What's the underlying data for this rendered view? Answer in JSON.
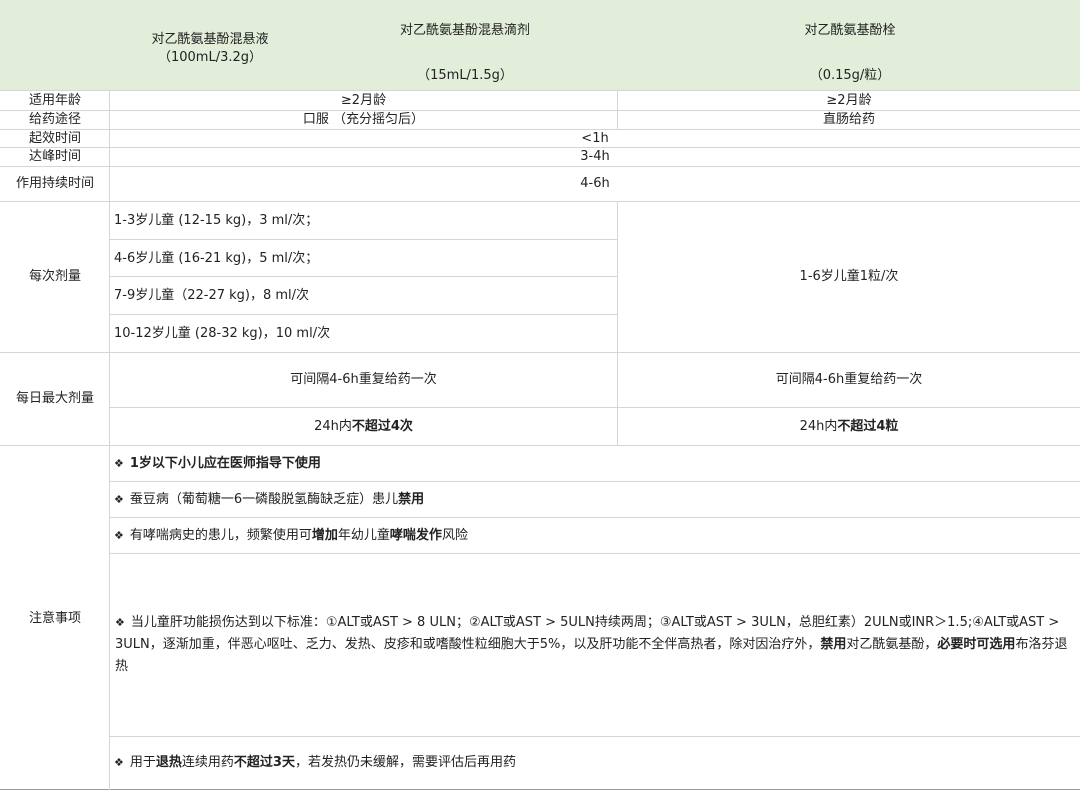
{
  "header": {
    "col1_name": "对乙酰氨基酚混悬液",
    "col1_spec": "（100mL/3.2g）",
    "col2_name": "对乙酰氨基酚混悬滴剂",
    "col2_spec": "（15mL/1.5g）",
    "col3_name": "对乙酰氨基酚栓",
    "col3_spec": "（0.15g/粒）"
  },
  "rows": {
    "age": {
      "label": "适用年龄",
      "left": "≥2月龄",
      "right": "≥2月龄"
    },
    "route": {
      "label": "给药途径",
      "left": "口服 （充分摇匀后）",
      "right": "直肠给药"
    },
    "onset": {
      "label": "起效时间",
      "value": "<1h"
    },
    "peak": {
      "label": "达峰时间",
      "value": "3-4h"
    },
    "duration": {
      "label": "作用持续时间",
      "value": "4-6h"
    },
    "dose": {
      "label": "每次剂量",
      "items": [
        "1-3岁儿童 (12-15 kg)，3 ml/次；",
        "4-6岁儿童 (16-21 kg)，5 ml/次；",
        "7-9岁儿童（22-27 kg)，8 ml/次",
        "10-12岁儿童 (28-32 kg)，10 ml/次"
      ],
      "right": "1-6岁儿童1粒/次"
    },
    "max": {
      "label": "每日最大剂量",
      "left_repeat": "可间隔4-6h重复给药一次",
      "right_repeat": "可间隔4-6h重复给药一次",
      "left_limit_pre": "24h内",
      "left_limit_bold": "不超过4次",
      "right_limit_pre": "24h内",
      "right_limit_bold": "不超过4粒"
    }
  },
  "notes": {
    "label": "注意事项",
    "bullet": "❖",
    "n1": "1岁以下小儿应在医师指导下使用",
    "n2_pre": "蚕豆病（葡萄糖一6一磷酸脱氢酶缺乏症）患儿",
    "n2_bold": "禁用",
    "n3_a": "有哮喘病史的患儿，频繁使用可",
    "n3_b": "增加",
    "n3_c": "年幼儿童",
    "n3_d": "哮喘发作",
    "n3_e": "风险",
    "n4_a": "当儿童肝功能损伤达到以下标准：①ALT或AST > 8 ULN；②ALT或AST > 5ULN持续两周；③ALT或AST > 3ULN，总胆红素）2ULN或INR＞1.5;④ALT或AST > 3ULN，逐渐加重，伴恶心呕吐、乏力、发热、皮疹和或嗜酸性粒细胞大于5%，以及肝功能不全伴高热者，除对因治疗外，",
    "n4_b": "禁用",
    "n4_c": "对乙酰氨基酚，",
    "n4_d": "必要时可选用",
    "n4_e": "布洛芬退热",
    "n5_a": "用于",
    "n5_b": "退热",
    "n5_c": "连续用药",
    "n5_d": "不超过3天",
    "n5_e": "，若发热仍未缓解，需要评估后再用药"
  }
}
